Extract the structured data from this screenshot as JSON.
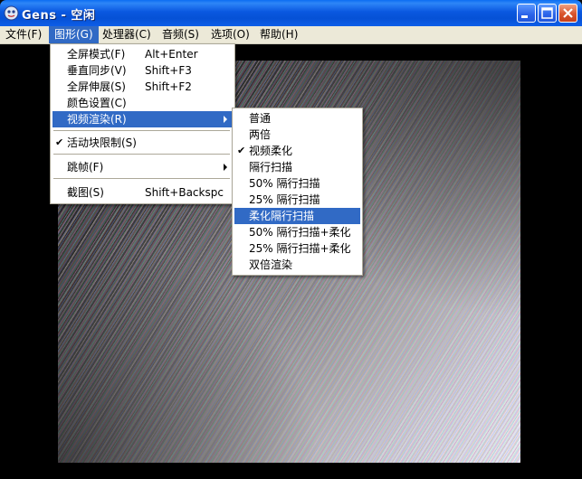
{
  "window": {
    "title": "Gens - 空闲",
    "colors": {
      "titlebar": "#0a58e0",
      "menu_highlight": "#316ac5",
      "menubar_bg": "#ece9d8"
    }
  },
  "menubar": {
    "items": [
      {
        "label": "文件(F)"
      },
      {
        "label": "图形(G)"
      },
      {
        "label": "处理器(C)"
      },
      {
        "label": "音频(S)"
      },
      {
        "label": "选项(O)"
      },
      {
        "label": "帮助(H)"
      }
    ]
  },
  "graphics_menu": {
    "items": [
      {
        "label": "全屏模式(F)",
        "shortcut": "Alt+Enter"
      },
      {
        "label": "垂直同步(V)",
        "shortcut": "Shift+F3"
      },
      {
        "label": "全屏伸展(S)",
        "shortcut": "Shift+F2"
      },
      {
        "label": "颜色设置(C)",
        "shortcut": ""
      },
      {
        "label": "视频渲染(R)",
        "shortcut": ""
      },
      {
        "label": "活动块限制(S)",
        "shortcut": ""
      },
      {
        "label": "跳帧(F)",
        "shortcut": ""
      },
      {
        "label": "截图(S)",
        "shortcut": "Shift+Backspc"
      }
    ]
  },
  "render_submenu": {
    "items": [
      {
        "label": "普通"
      },
      {
        "label": "两倍"
      },
      {
        "label": "视频柔化"
      },
      {
        "label": "隔行扫描"
      },
      {
        "label": "50% 隔行扫描"
      },
      {
        "label": "25% 隔行扫描"
      },
      {
        "label": "柔化隔行扫描"
      },
      {
        "label": "50% 隔行扫描+柔化"
      },
      {
        "label": "25% 隔行扫描+柔化"
      },
      {
        "label": "双倍渲染"
      }
    ]
  }
}
